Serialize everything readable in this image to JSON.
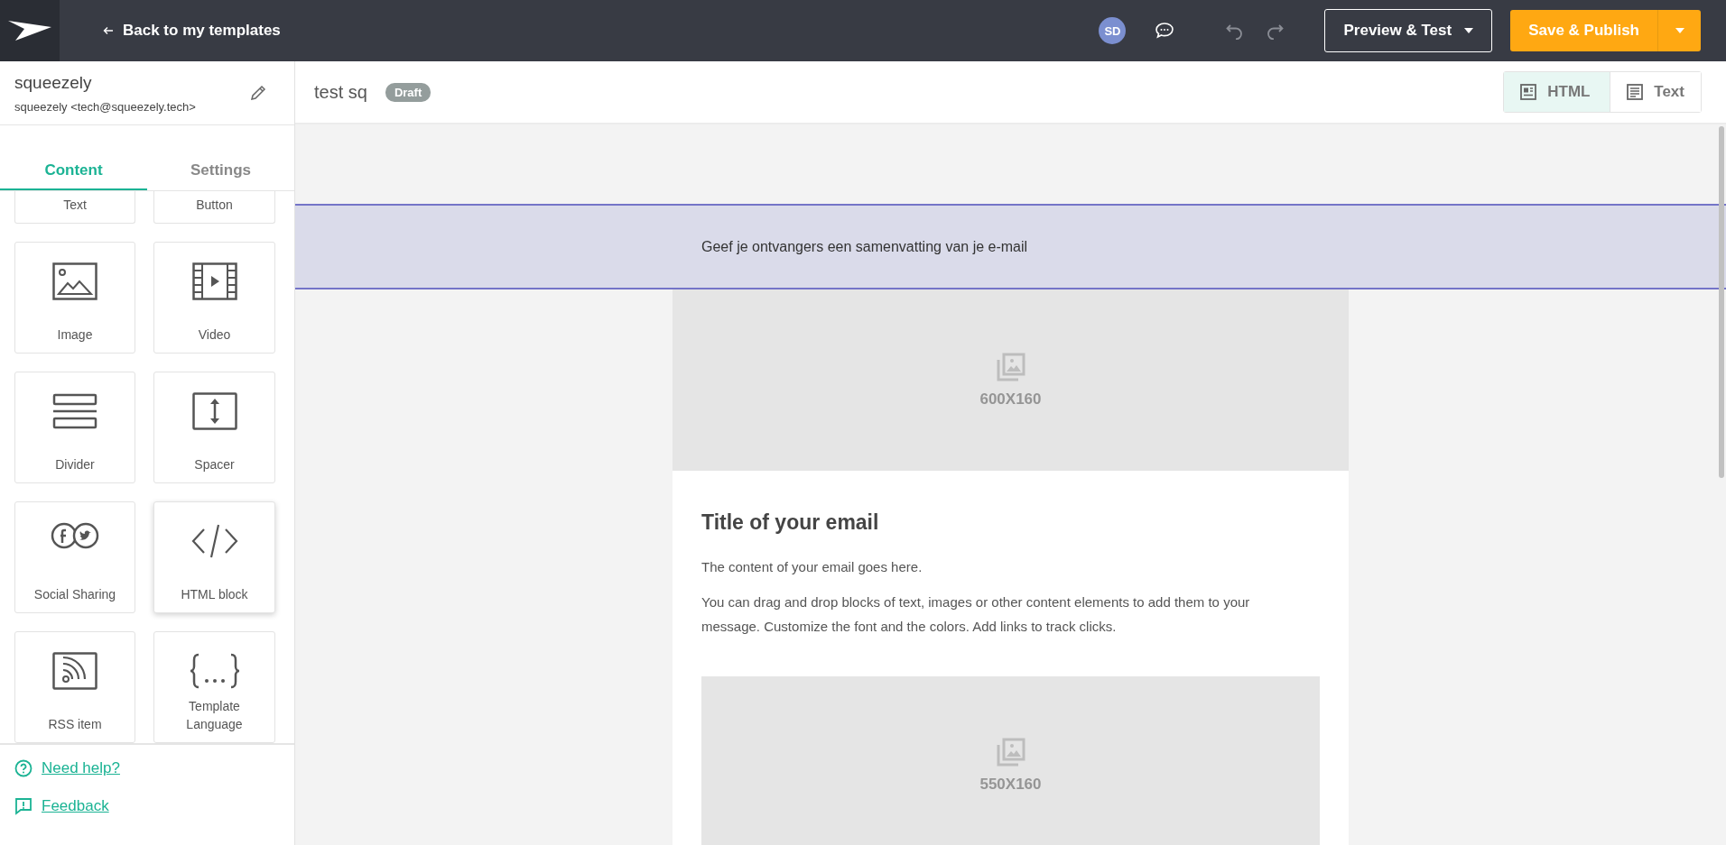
{
  "topbar": {
    "back_link": "Back to my templates",
    "avatar": "SD",
    "preview_button": "Preview & Test",
    "save_button": "Save & Publish"
  },
  "sender": {
    "name": "squeezely",
    "address": "squeezely <tech@squeezely.tech>"
  },
  "template": {
    "name": "test sq",
    "status": "Draft"
  },
  "view_toggle": [
    {
      "label": "HTML",
      "kind": "html",
      "selected": true
    },
    {
      "label": "Text",
      "kind": "text",
      "selected": false
    }
  ],
  "tabs": [
    {
      "label": "Content",
      "selected": true
    },
    {
      "label": "Settings",
      "selected": false
    }
  ],
  "partial_blocks": [
    "Text",
    "Button"
  ],
  "blocks": [
    {
      "label": "Image",
      "kind": "image",
      "hovered": false
    },
    {
      "label": "Video",
      "kind": "video",
      "hovered": false
    },
    {
      "label": "Divider",
      "kind": "divider",
      "hovered": false
    },
    {
      "label": "Spacer",
      "kind": "spacer",
      "hovered": false
    },
    {
      "label": "Social Sharing",
      "kind": "social",
      "hovered": false
    },
    {
      "label": "HTML block",
      "kind": "html",
      "hovered": true
    },
    {
      "label": "RSS item",
      "kind": "rss",
      "hovered": false
    },
    {
      "label": "Template Language",
      "kind": "template",
      "hovered": false
    }
  ],
  "footer_links": [
    {
      "label": "Need help?",
      "kind": "help"
    },
    {
      "label": "Feedback",
      "kind": "feedback"
    }
  ],
  "email": {
    "preheader": "Geef je ontvangers een samenvatting van je e-mail",
    "header_image": "600X160",
    "title": "Title of your email",
    "paragraphs": [
      "The content of your email goes here.",
      "You can drag and drop blocks of text, images or other content elements to add them to your message. Customize the font and the colors. Add links to track clicks."
    ],
    "body_image": "550X160"
  }
}
